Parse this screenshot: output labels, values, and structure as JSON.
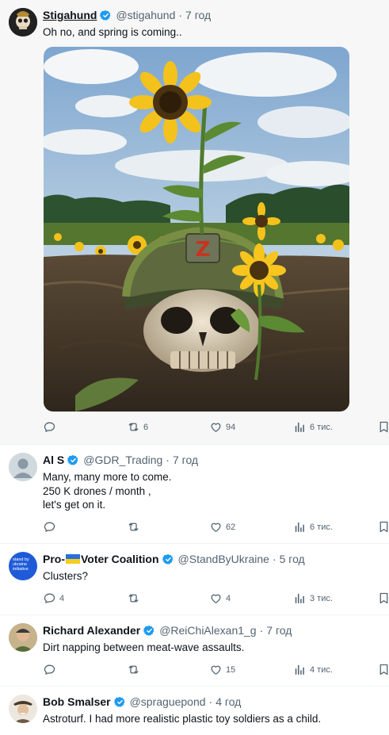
{
  "tweets": [
    {
      "name": "Stigahund",
      "handle": "@stigahund",
      "time": "7 год",
      "text": "Oh no, and spring is coming..",
      "replies": "",
      "retweets": "6",
      "likes": "94",
      "views": "6 тис."
    },
    {
      "name": "Al S",
      "handle": "@GDR_Trading",
      "time": "7 год",
      "text": "Many, many more to come.\n250 K drones / month ,\nlet's get on it.",
      "replies": "",
      "retweets": "",
      "likes": "62",
      "views": "6 тис."
    },
    {
      "name_before_flag": "Pro-",
      "name_after_flag": " Voter Coalition",
      "handle": "@StandByUkraine",
      "time": "5 год",
      "text": "Clusters?",
      "replies": "4",
      "retweets": "",
      "likes": "4",
      "views": "3 тис.",
      "avatar_text": "stand by ukraine initiative"
    },
    {
      "name": "Richard Alexander",
      "handle": "@ReiChiAlexan1_g",
      "time": "7 год",
      "text": "Dirt napping between meat-wave assaults.",
      "replies": "",
      "retweets": "",
      "likes": "15",
      "views": "4 тис."
    },
    {
      "name": "Bob Smalser",
      "handle": "@spraguepond",
      "time": "4 год",
      "text": "Astroturf.  I had more realistic plastic toy soldiers as a child."
    }
  ],
  "dot": "·",
  "colors": {
    "verified": "#1d9bf0",
    "secondary_text": "#536471",
    "avatar_blue": "#1f5bd8"
  },
  "icons": [
    "reply-icon",
    "retweet-icon",
    "like-icon",
    "views-icon",
    "bookmark-icon",
    "verified-badge-icon",
    "ukraine-flag-icon"
  ]
}
